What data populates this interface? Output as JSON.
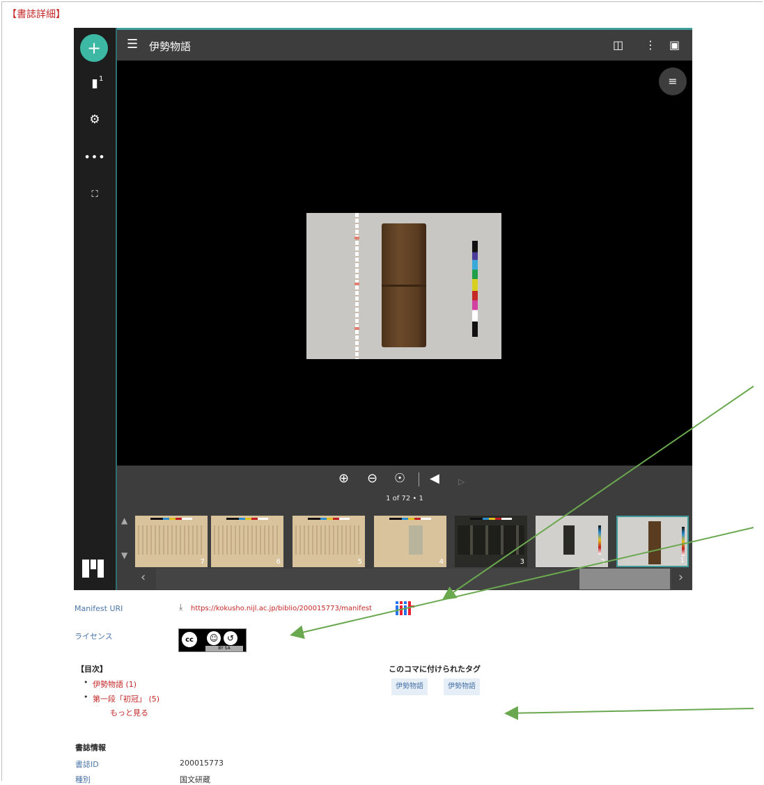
{
  "page": {
    "heading": "【書誌詳細】"
  },
  "viewer": {
    "title": "伊勢物語",
    "bookmark_count": "1",
    "page_info": "1 of 72 • 1",
    "thumbnails": [
      "7",
      "6",
      "5",
      "4",
      "3",
      "2",
      "1"
    ],
    "icons": {
      "add": "plus-icon",
      "bookmark": "bookmark-icon",
      "settings": "gear-icon",
      "more": "more-horizontal-icon",
      "fullscreen_small": "expand-icon",
      "menu": "hamburger-menu-icon",
      "layout": "book-view-icon",
      "more_vert": "more-vertical-icon",
      "maximize": "maximize-icon",
      "adjust": "image-adjust-icon",
      "zoom_in": "zoom-in-icon",
      "zoom_out": "zoom-out-icon",
      "reset": "reset-view-icon",
      "prev": "previous-page-icon",
      "next": "next-page-icon"
    },
    "accent_color": "#3cb8a4"
  },
  "metadata": {
    "manifest_label": "Manifest URI",
    "manifest_url": "https://kokusho.nijl.ac.jp/biblio/200015773/manifest",
    "license_label": "ライセンス",
    "license_badge": "BY SA",
    "toc_title": "【目次】",
    "toc_items": [
      "伊勢物語 (1)",
      "第一段「初冠」 (5)"
    ],
    "toc_more": "もっと見る",
    "tags_title": "このコマに付けられたタグ",
    "tags": [
      "伊勢物語",
      "伊勢物語"
    ],
    "biblio_title": "書誌情報",
    "fields": [
      {
        "label": "書誌ID",
        "value": "200015773"
      },
      {
        "label": "種別",
        "value": "国文研蔵"
      }
    ],
    "link_color": "#c62828"
  }
}
